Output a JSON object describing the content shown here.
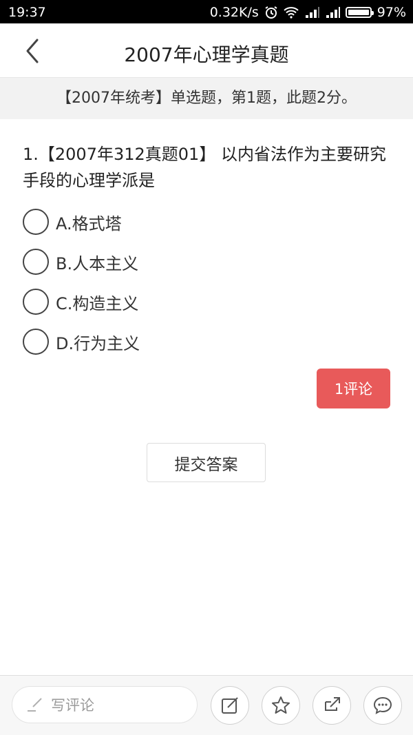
{
  "status": {
    "time": "19:37",
    "speed": "0.32K/s",
    "battery": "97%"
  },
  "header": {
    "title": "2007年心理学真题",
    "back_icon": "chevron-left-icon"
  },
  "info": {
    "text": "【2007年统考】单选题，第1题，此题2分。"
  },
  "question": {
    "text": "1.【2007年312真题01】 以内省法作为主要研究手段的心理学派是",
    "options": [
      {
        "label": "A.格式塔"
      },
      {
        "label": "B.人本主义"
      },
      {
        "label": "C.构造主义"
      },
      {
        "label": "D.行为主义"
      }
    ]
  },
  "actions": {
    "comment_button": "1评论",
    "submit_button": "提交答案"
  },
  "bottom": {
    "comment_placeholder": "写评论",
    "icons": [
      "edit-icon",
      "star-icon",
      "share-icon",
      "chat-icon"
    ]
  },
  "colors": {
    "accent": "#e85a5a",
    "info_bg": "#f2f2f2"
  }
}
